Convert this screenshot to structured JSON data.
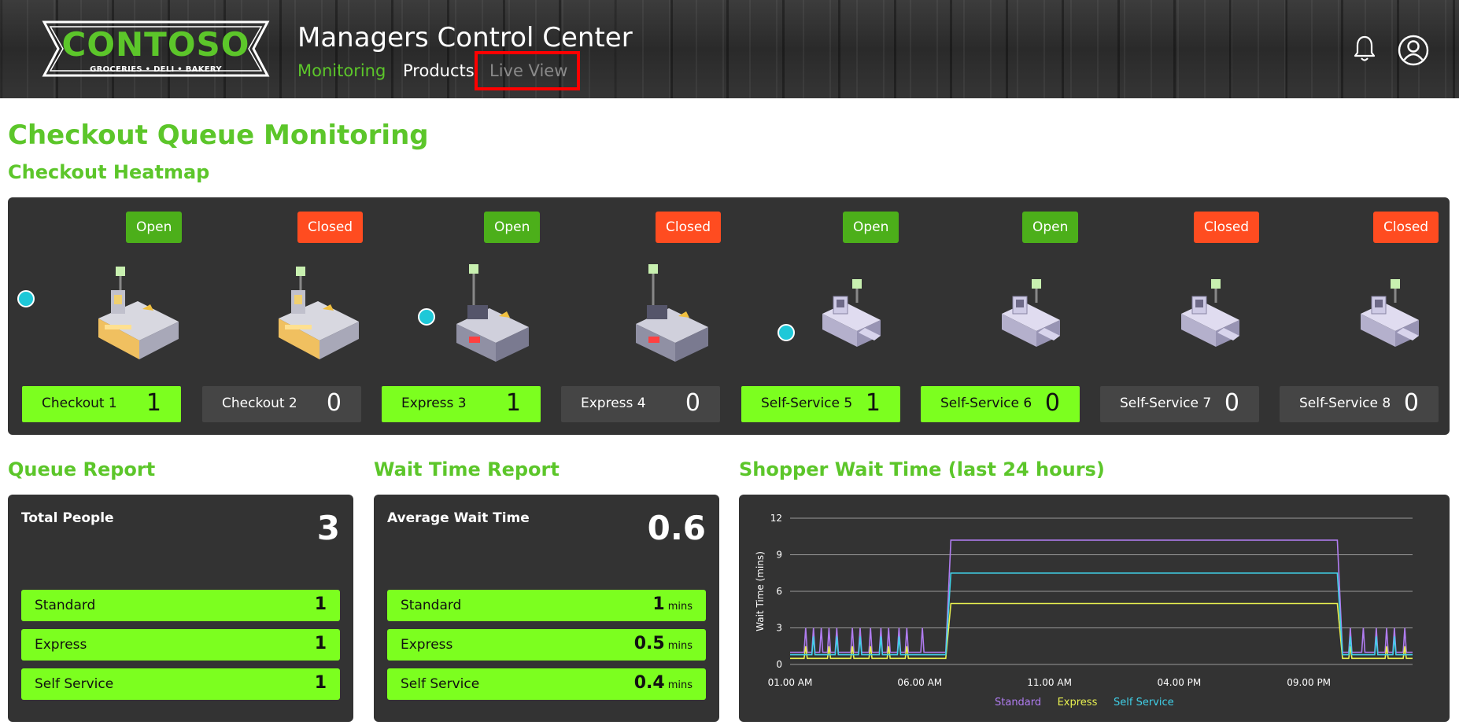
{
  "header": {
    "logo_text": "CONTOSO",
    "logo_tagline": "GROCERIES • DELI • BAKERY",
    "title": "Managers Control Center",
    "nav": {
      "monitoring": "Monitoring",
      "products": "Products",
      "live_view": "Live View"
    },
    "icons": {
      "bell": "bell-icon",
      "user": "user-icon"
    }
  },
  "page": {
    "title": "Checkout Queue Monitoring",
    "heatmap_title": "Checkout Heatmap"
  },
  "lanes": [
    {
      "name": "Checkout 1",
      "count": "1",
      "status": "Open",
      "kind": "checkout",
      "has_person": true
    },
    {
      "name": "Checkout 2",
      "count": "0",
      "status": "Closed",
      "kind": "checkout",
      "has_person": false
    },
    {
      "name": "Express 3",
      "count": "1",
      "status": "Open",
      "kind": "express",
      "has_person": true
    },
    {
      "name": "Express 4",
      "count": "0",
      "status": "Closed",
      "kind": "express",
      "has_person": false
    },
    {
      "name": "Self-Service 5",
      "count": "1",
      "status": "Open",
      "kind": "self",
      "has_person": true
    },
    {
      "name": "Self-Service 6",
      "count": "0",
      "status": "Open",
      "kind": "self",
      "has_person": false
    },
    {
      "name": "Self-Service 7",
      "count": "0",
      "status": "Closed",
      "kind": "self",
      "has_person": false
    },
    {
      "name": "Self-Service 8",
      "count": "0",
      "status": "Closed",
      "kind": "self",
      "has_person": false
    }
  ],
  "queue_report": {
    "title": "Queue Report",
    "label": "Total People",
    "total": "3",
    "rows": [
      {
        "name": "Standard",
        "value": "1"
      },
      {
        "name": "Express",
        "value": "1"
      },
      {
        "name": "Self Service",
        "value": "1"
      }
    ]
  },
  "wait_report": {
    "title": "Wait Time Report",
    "label": "Average Wait Time",
    "average": "0.6",
    "unit": "mins",
    "rows": [
      {
        "name": "Standard",
        "value": "1"
      },
      {
        "name": "Express",
        "value": "0.5"
      },
      {
        "name": "Self Service",
        "value": "0.4"
      }
    ]
  },
  "colors": {
    "accent": "#5cc62a",
    "tile_active": "#7cff1f",
    "closed": "#ff4c20",
    "open": "#4caf1a",
    "person": "#1ec8d8"
  },
  "chart_data": {
    "type": "line",
    "title": "Shopper Wait Time (last 24 hours)",
    "ylabel": "Wait Time (mins)",
    "xlabel": "",
    "ylim": [
      0,
      12
    ],
    "yticks": [
      0,
      3,
      6,
      9,
      12
    ],
    "xtick_labels": [
      "01.00 AM",
      "06.00 AM",
      "11.00 AM",
      "04.00 PM",
      "09.00 PM"
    ],
    "xlim_hours": [
      1,
      25
    ],
    "grid": true,
    "legend_position": "bottom",
    "series": [
      {
        "name": "Standard",
        "color": "#b07cf0",
        "points": [
          [
            1,
            1
          ],
          [
            7,
            1
          ],
          [
            7.2,
            10.2
          ],
          [
            22.1,
            10.2
          ],
          [
            22.3,
            1
          ],
          [
            25,
            1
          ]
        ],
        "spikes": [
          1.6,
          1.9,
          2.2,
          2.5,
          2.8,
          3.4,
          3.7,
          4.1,
          4.5,
          4.8,
          5.2,
          5.5,
          6.1,
          22.6,
          23.1,
          23.6,
          24.0,
          24.3,
          24.7
        ],
        "spike_height": 2
      },
      {
        "name": "Express",
        "color": "#e8f050",
        "points": [
          [
            1,
            0.5
          ],
          [
            7,
            0.5
          ],
          [
            7.2,
            5
          ],
          [
            22.1,
            5
          ],
          [
            22.3,
            0.5
          ],
          [
            25,
            0.5
          ]
        ],
        "spikes": [
          1.6,
          2.5,
          3.4,
          4.1,
          4.8,
          5.5,
          22.6,
          24.0,
          24.7
        ],
        "spike_height": 1
      },
      {
        "name": "Self Service",
        "color": "#40d0e8",
        "points": [
          [
            1,
            0.8
          ],
          [
            7,
            0.8
          ],
          [
            7.2,
            7.5
          ],
          [
            22.1,
            7.5
          ],
          [
            22.3,
            0.8
          ],
          [
            25,
            0.8
          ]
        ],
        "spikes": [
          1.9,
          2.8,
          3.7,
          4.5,
          5.2,
          22.6,
          23.6,
          24.3
        ],
        "spike_height": 1.5
      }
    ]
  }
}
